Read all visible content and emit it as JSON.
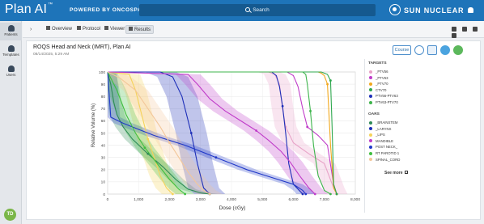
{
  "header": {
    "app_name": "Plan AI",
    "trademark": "™",
    "powered": "POWERED BY ONCOSPACE",
    "search_label": "Search",
    "brand": "SUN NUCLEAR"
  },
  "sidebar": {
    "items": [
      {
        "label": "Patients",
        "icon": "patients-icon"
      },
      {
        "label": "Templates",
        "icon": "templates-icon"
      },
      {
        "label": "Users",
        "icon": "users-icon"
      }
    ],
    "avatar": "TD"
  },
  "tabs": [
    {
      "label": "Overview",
      "icon": "home-icon"
    },
    {
      "label": "Protocol",
      "icon": "document-icon"
    },
    {
      "label": "Viewer",
      "icon": "image-icon"
    },
    {
      "label": "Results",
      "icon": "chart-icon"
    }
  ],
  "panel": {
    "title": "ROQS Head and Neck (IMRT), Plan AI",
    "date": "08/14/2025, 5:29 AM",
    "course_button": "Course"
  },
  "legend": {
    "targets_heading": "TARGETS",
    "oars_heading": "OARS",
    "see_more": "See more",
    "targets": [
      {
        "label": "_PTV56",
        "color": "#e8a3c8"
      },
      {
        "label": "_PTV63",
        "color": "#c03cc9"
      },
      {
        "label": "_PTV70",
        "color": "#f2a81d"
      },
      {
        "label": "CTV70",
        "color": "#2fa84f"
      },
      {
        "label": "PTV56-PTV63",
        "color": "#1d2fb8"
      },
      {
        "label": "PTV63-PTV70",
        "color": "#3cb44b"
      }
    ],
    "oars": [
      {
        "label": "_BRAINSTEM",
        "color": "#2e8b57"
      },
      {
        "label": "_LARYNX",
        "color": "#1d2fb8"
      },
      {
        "label": "_LIPS",
        "color": "#f5d35a"
      },
      {
        "label": "MANDIBLE",
        "color": "#c03cc9"
      },
      {
        "label": "POST NECK_",
        "color": "#2038c8"
      },
      {
        "label": "RT PAROTID 1",
        "color": "#3fbf3f"
      },
      {
        "label": "SPINAL_CORD",
        "color": "#f3c79a"
      }
    ]
  },
  "chart_data": {
    "type": "line",
    "xlabel": "Dose (cGy)",
    "ylabel": "Relative Volume (%)",
    "xlim": [
      0,
      8000
    ],
    "ylim": [
      0,
      100
    ],
    "xticks": [
      "0",
      "1,000",
      "2,000",
      "3,000",
      "4,000",
      "5,000",
      "6,000",
      "7,000",
      "8,000"
    ],
    "yticks": [
      "0",
      "10",
      "20",
      "30",
      "40",
      "50",
      "60",
      "70",
      "80",
      "90",
      "100"
    ],
    "series": [
      {
        "name": "_PTV56",
        "color": "#e8a3c8",
        "x": [
          0,
          5200,
          5400,
          5550,
          5650,
          5750,
          6000,
          6500,
          7000,
          7300,
          7400
        ],
        "y": [
          100,
          100,
          98,
          90,
          70,
          55,
          42,
          33,
          25,
          5,
          0
        ]
      },
      {
        "name": "_PTV63",
        "color": "#c03cc9",
        "x": [
          0,
          5800,
          6000,
          6150,
          6300,
          6450,
          6800,
          7100,
          7300,
          7400
        ],
        "y": [
          100,
          100,
          97,
          88,
          70,
          55,
          48,
          40,
          8,
          0
        ]
      },
      {
        "name": "_PTV70",
        "color": "#f2a81d",
        "x": [
          0,
          6800,
          6900,
          7000,
          7100,
          7200,
          7300,
          7400
        ],
        "y": [
          100,
          100,
          99,
          97,
          90,
          40,
          5,
          0
        ]
      },
      {
        "name": "CTV70",
        "color": "#2fa84f",
        "x": [
          0,
          6900,
          7000,
          7100,
          7200,
          7250,
          7300,
          7400
        ],
        "y": [
          100,
          100,
          99,
          98,
          93,
          55,
          8,
          0
        ]
      },
      {
        "name": "PTV56-PTV63",
        "color": "#1d2fb8",
        "x": [
          0,
          5300,
          5450,
          5550,
          5650,
          5750,
          5850,
          6000,
          6300
        ],
        "y": [
          100,
          100,
          97,
          88,
          72,
          50,
          25,
          8,
          0
        ]
      },
      {
        "name": "PTV63-PTV70",
        "color": "#3cb44b",
        "x": [
          0,
          6300,
          6400,
          6450,
          6550,
          6650,
          6800,
          7000,
          7200
        ],
        "y": [
          100,
          100,
          98,
          90,
          68,
          40,
          15,
          3,
          0
        ]
      },
      {
        "name": "_BRAINSTEM",
        "color": "#2e8b57",
        "x": [
          0,
          100,
          200,
          300,
          500,
          800,
          1300,
          1800,
          2200,
          2600,
          3000,
          3300
        ],
        "y": [
          100,
          90,
          75,
          65,
          55,
          45,
          33,
          22,
          12,
          4,
          1,
          0
        ]
      },
      {
        "name": "_LARYNX",
        "color": "#1d2fb8",
        "x": [
          0,
          1700,
          2100,
          2400,
          2700,
          2900,
          3100,
          3300
        ],
        "y": [
          100,
          100,
          96,
          80,
          50,
          25,
          5,
          0
        ]
      },
      {
        "name": "_LIPS",
        "color": "#f5d35a",
        "x": [
          0,
          700,
          900,
          1100,
          1300,
          1500,
          1700,
          1900,
          2100
        ],
        "y": [
          100,
          98,
          85,
          65,
          45,
          30,
          15,
          5,
          0
        ]
      },
      {
        "name": "MANDIBLE",
        "color": "#c03cc9",
        "x": [
          0,
          2600,
          2900,
          3300,
          3800,
          4300,
          4800,
          5200,
          5600,
          5900,
          6200,
          6500,
          6700
        ],
        "y": [
          100,
          98,
          90,
          78,
          68,
          60,
          52,
          44,
          35,
          26,
          15,
          5,
          0
        ]
      },
      {
        "name": "POST NECK_",
        "color": "#2038c8",
        "x": [
          0,
          100,
          500,
          1000,
          1500,
          2000,
          2500,
          3000,
          3500,
          4000,
          4500,
          5000,
          5500,
          6000,
          6300,
          6400
        ],
        "y": [
          100,
          63,
          58,
          53,
          48,
          44,
          40,
          35,
          30,
          25,
          20,
          16,
          12,
          8,
          3,
          0
        ]
      },
      {
        "name": "RT PAROTID 1",
        "color": "#3fbf3f",
        "x": [
          0,
          300,
          600,
          900,
          1200,
          1600,
          2000,
          2300,
          2500
        ],
        "y": [
          100,
          85,
          65,
          50,
          38,
          25,
          12,
          4,
          0
        ]
      },
      {
        "name": "SPINAL_CORD",
        "color": "#f3c79a",
        "x": [
          0,
          400,
          900,
          1300,
          1700,
          2000,
          2300,
          2600,
          2900,
          3100,
          3300
        ],
        "y": [
          100,
          95,
          85,
          70,
          55,
          42,
          30,
          18,
          8,
          3,
          0
        ]
      }
    ]
  }
}
